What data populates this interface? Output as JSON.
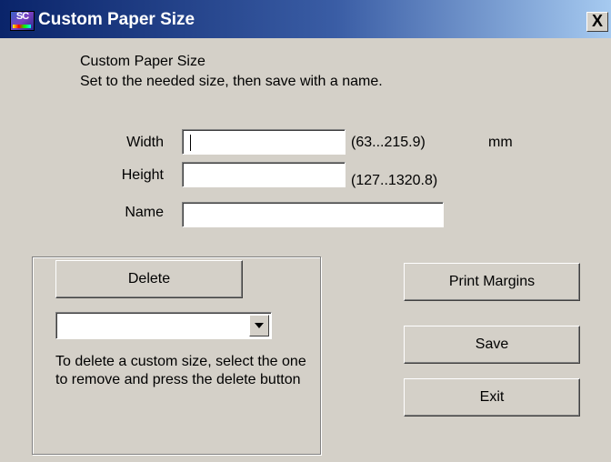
{
  "window": {
    "title": "Custom Paper Size",
    "close_label": "X",
    "logo_text": "SC"
  },
  "header": {
    "line1": "Custom Paper Size",
    "line2": "Set to the needed size, then save with a name."
  },
  "fields": {
    "width": {
      "label": "Width",
      "value": "",
      "range": "(63...215.9)",
      "unit": "mm"
    },
    "height": {
      "label": "Height",
      "value": "",
      "range": "(127..1320.8)"
    },
    "name": {
      "label": "Name",
      "value": ""
    }
  },
  "delete_group": {
    "delete_label": "Delete",
    "select_value": "",
    "help_text": "To delete a custom size, select the one to remove and press the delete button"
  },
  "buttons": {
    "print_margins": "Print Margins",
    "save": "Save",
    "exit": "Exit"
  }
}
